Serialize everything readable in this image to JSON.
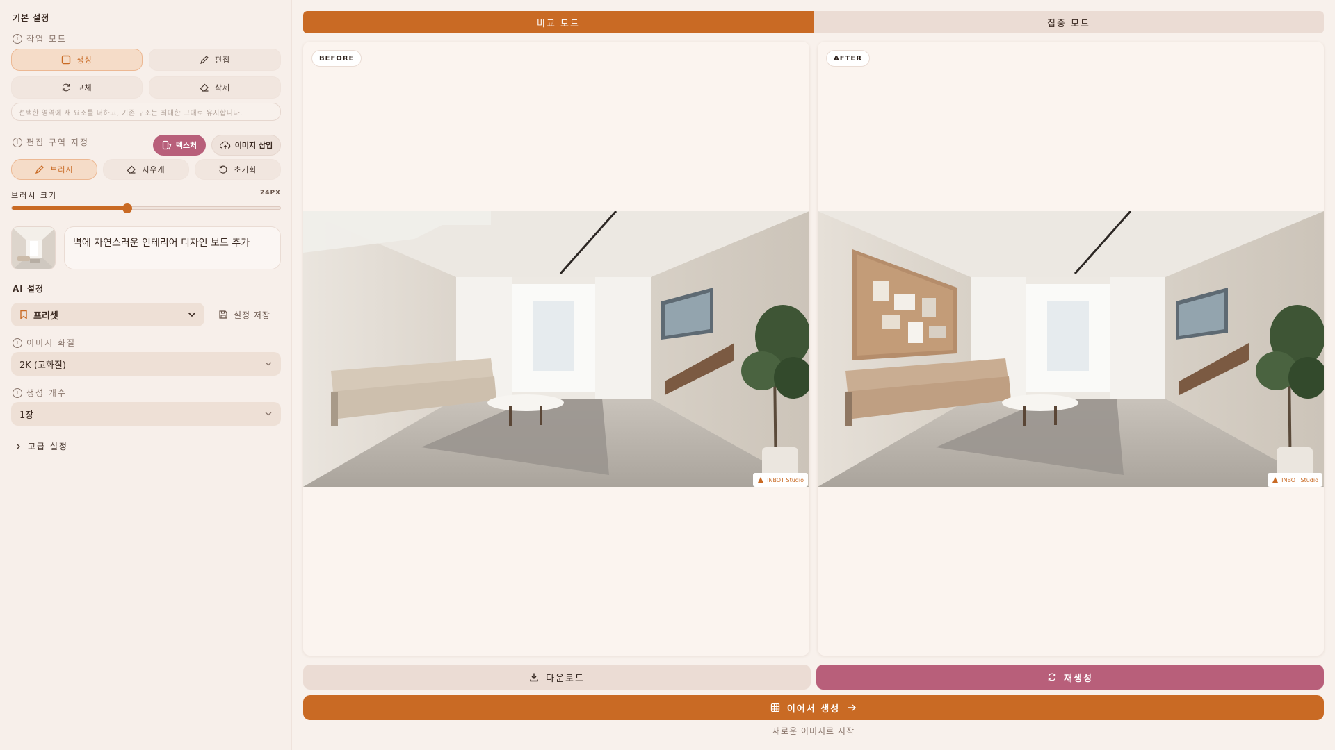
{
  "sidebar": {
    "basic_settings_title": "기본 설정",
    "work_mode_label": "작업 모드",
    "modes": [
      {
        "label": "생성",
        "icon": "square-icon",
        "active": true
      },
      {
        "label": "편집",
        "icon": "pencil-icon",
        "active": false
      },
      {
        "label": "교체",
        "icon": "refresh-icon",
        "active": false
      },
      {
        "label": "삭제",
        "icon": "eraser-icon",
        "active": false
      }
    ],
    "mode_hint": "선택한 영역에 새 요소를 더하고, 기존 구조는 최대한 그대로 유지합니다.",
    "edit_area_label": "편집 구역 지정",
    "texture_label": "텍스처",
    "image_insert_label": "이미지 삽입",
    "tools": [
      {
        "label": "브러시",
        "icon": "brush-icon",
        "active": true
      },
      {
        "label": "지우개",
        "icon": "eraser-icon",
        "active": false
      },
      {
        "label": "초기화",
        "icon": "reset-icon",
        "active": false
      }
    ],
    "brush_size_label": "브러시 크기",
    "brush_size_value": "24PX",
    "brush_size_fraction": 0.43,
    "prompt_text": "벽에 자연스러운 인테리어 디자인 보드 추가",
    "ai_settings_title": "AI 설정",
    "preset_label": "프리셋",
    "save_settings_label": "설정 저장",
    "image_quality_label": "이미지 화질",
    "image_quality_value": "2K (고화질)",
    "count_label": "생성 개수",
    "count_value": "1장",
    "advanced_label": "고급 설정"
  },
  "main": {
    "tabs": [
      {
        "label": "비교 모드",
        "active": true
      },
      {
        "label": "집중 모드",
        "active": false
      }
    ],
    "before_label": "BEFORE",
    "after_label": "AFTER",
    "watermark": "INBOT Studio",
    "download_label": "다운로드",
    "regenerate_label": "재생성",
    "continue_label": "이어서 생성",
    "new_image_label": "새로운 이미지로 시작"
  },
  "colors": {
    "accent": "#c96a24",
    "rose": "#b85f7a",
    "background": "#f8f1ec"
  }
}
